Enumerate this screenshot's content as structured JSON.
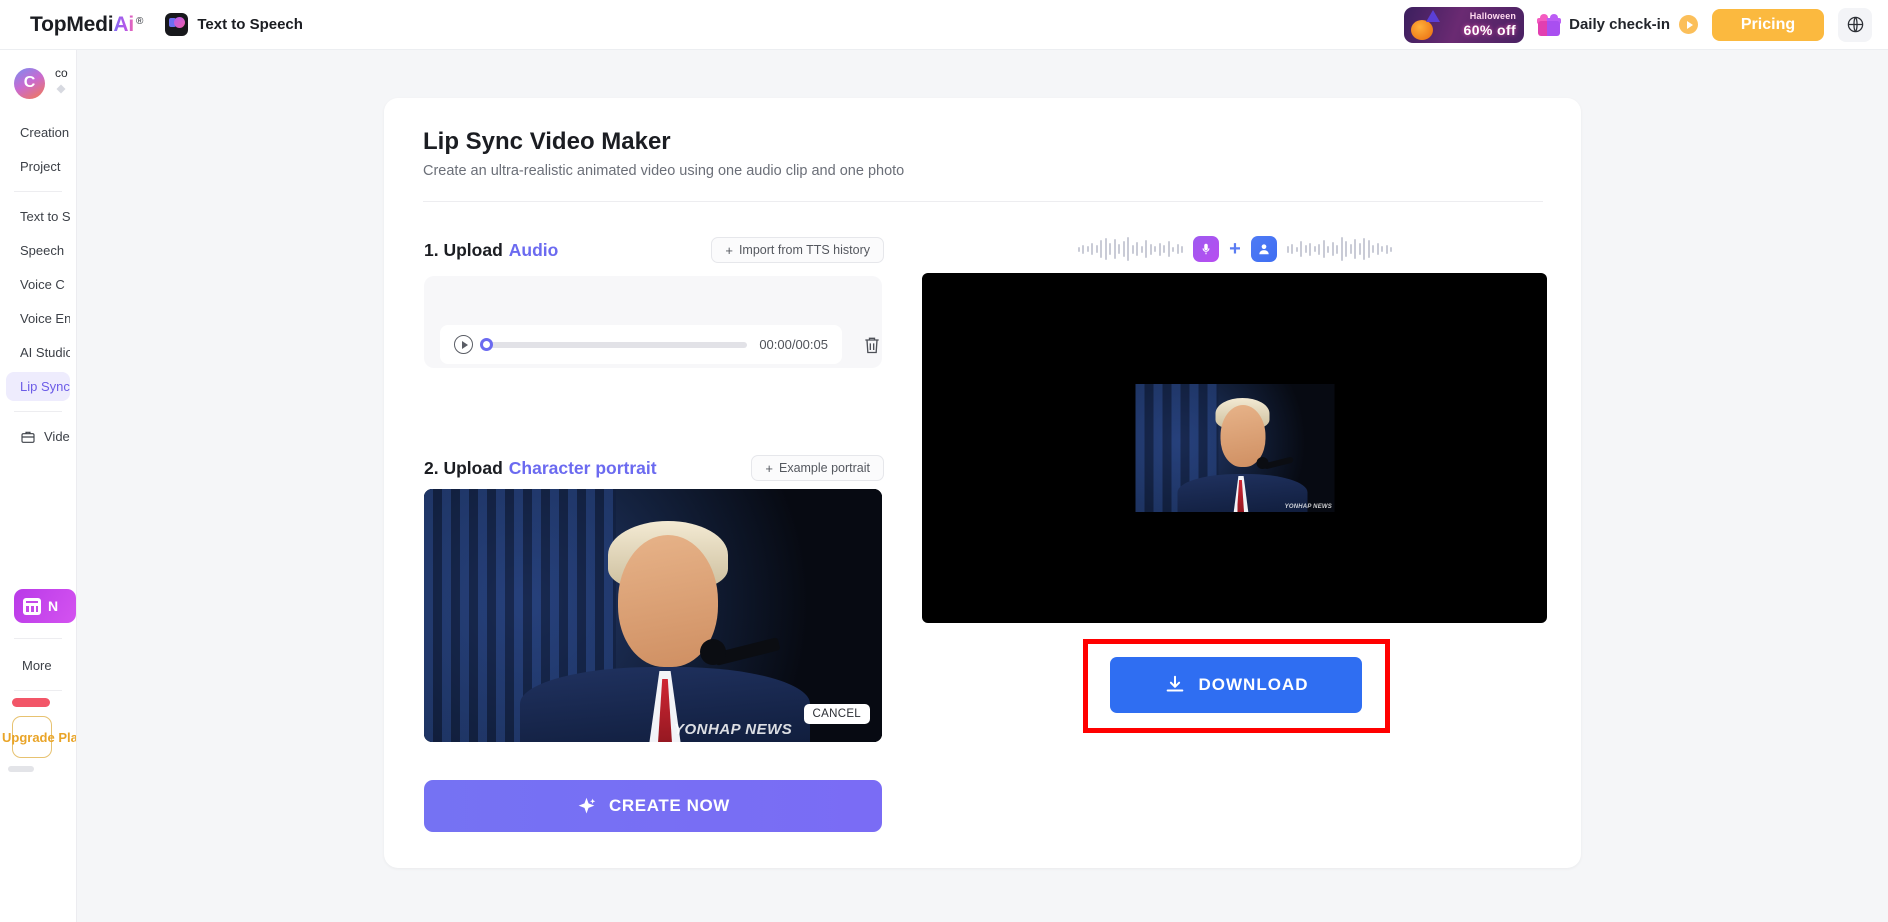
{
  "topbar": {
    "brand_main": "TopMedi",
    "brand_ai": "Ai",
    "brand_reg": "®",
    "app_label": "Text to Speech",
    "promo": {
      "line1": "Halloween",
      "line2": "60% off"
    },
    "checkin_label": "Daily check-in",
    "pricing_label": "Pricing",
    "language_icon": "globe-icon"
  },
  "sidebar": {
    "user": {
      "initial": "C",
      "name": "co"
    },
    "items": [
      {
        "label": "Creation",
        "active": false
      },
      {
        "label": "Project",
        "active": false
      },
      {
        "label": "Text to S",
        "active": false
      },
      {
        "label": "Speech",
        "active": false
      },
      {
        "label": "Voice C",
        "active": false
      },
      {
        "label": "Voice En",
        "active": false
      },
      {
        "label": "AI Studio",
        "active": false
      },
      {
        "label": "Lip Sync",
        "active": true
      }
    ],
    "video_item": {
      "label": "Vide",
      "icon": "briefcase-icon"
    },
    "promo_label": "N",
    "more_label": "More",
    "upgrade_label": "Upgrade Plan"
  },
  "card": {
    "title": "Lip Sync Video Maker",
    "subtitle": "Create an ultra-realistic animated video using one audio clip and one photo",
    "step1": {
      "number": "1. Upload",
      "keyword": "Audio",
      "action_label": "Import from TTS history",
      "action_plus": "+",
      "player": {
        "time": "00:00/00:05",
        "progress_percent": 0,
        "play_icon": "play-icon",
        "delete_icon": "trash-icon"
      }
    },
    "step2": {
      "number": "2. Upload",
      "keyword": "Character portrait",
      "action_label": "Example portrait",
      "action_plus": "+",
      "cancel_label": "CANCEL",
      "watermark": "YONHAP NEWS"
    },
    "create_label": "CREATE NOW",
    "create_icon": "sparkle-icon"
  },
  "preview": {
    "icons": {
      "mic": "microphone-icon",
      "plus": "+",
      "person": "person-icon"
    },
    "video_watermark": "YONHAP NEWS",
    "download_label": "DOWNLOAD",
    "download_icon": "download-icon",
    "highlight_color": "#ff0000"
  },
  "colors": {
    "accent_purple": "#6b6af0",
    "accent_blue": "#2f6ef2",
    "pricing_yellow": "#fbb93f",
    "upgrade_gold": "#e9a427"
  }
}
